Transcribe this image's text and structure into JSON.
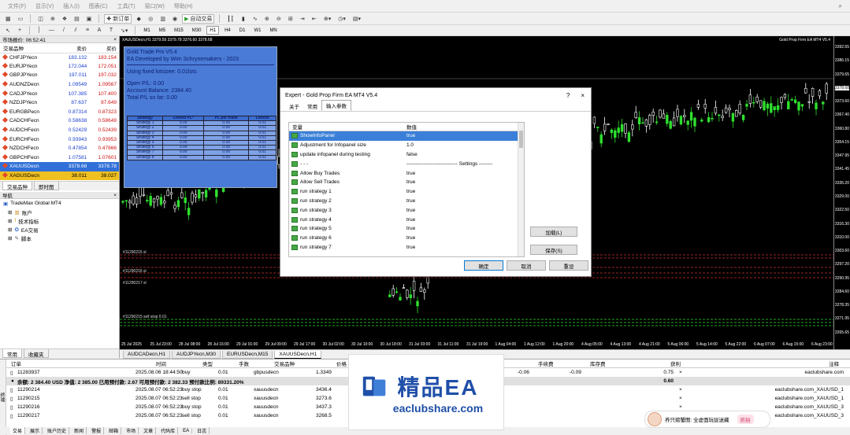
{
  "menu": [
    "文件(F)",
    "显示(V)",
    "插入(I)",
    "图表(C)",
    "工具(T)",
    "窗口(W)",
    "帮助(H)"
  ],
  "toolbar": {
    "new_order": "新订单",
    "auto_trading": "自动交易"
  },
  "timeframes": [
    "M1",
    "M5",
    "M15",
    "M30",
    "H1",
    "H4",
    "D1",
    "W1",
    "MN"
  ],
  "active_timeframe": "H1",
  "market_watch": {
    "title": "市场报价: 06:52:41",
    "headers": [
      "交易品种",
      "卖价",
      "买价"
    ],
    "rows": [
      [
        "CHFJPYecn",
        "183.132",
        "183.154"
      ],
      [
        "EURJPYecn",
        "172.044",
        "172.051"
      ],
      [
        "GBPJPYecn",
        "197.011",
        "197.032"
      ],
      [
        "AUDNZDecn",
        "1.09549",
        "1.09567"
      ],
      [
        "CADJPYecn",
        "107.385",
        "107.400"
      ],
      [
        "NZDJPYecn",
        "87.637",
        "87.649"
      ],
      [
        "EURGBPecn",
        "0.87314",
        "0.87323"
      ],
      [
        "CADCHFecn",
        "0.58638",
        "0.58649"
      ],
      [
        "AUDCHFecn",
        "0.52429",
        "0.52439"
      ],
      [
        "EURCHFecn",
        "0.93943",
        "0.93953"
      ],
      [
        "NZDCHFecn",
        "0.47854",
        "0.47866"
      ],
      [
        "GBPCHFecn",
        "1.07581",
        "1.07601"
      ],
      [
        "XAUUSDecn",
        "3378.68",
        "3378.78"
      ],
      [
        "XAGUSDecn",
        "38.011",
        "38.027"
      ]
    ],
    "tabs": [
      "交易品种",
      "即时图"
    ]
  },
  "navigator": {
    "title": "导航",
    "root": "TradeMax Global MT4",
    "items": [
      "账户",
      "技术指标",
      "EA交易",
      "脚本"
    ],
    "tabs": [
      "常用",
      "收藏夹"
    ]
  },
  "chart": {
    "header": "XAUUSDecn,H1  3379.59 3379.78 3376.60 3378.68",
    "ea_label": "Gold Prop Firm EA MT4 V5.4",
    "price_ticks": [
      "3392.65",
      "3386.15",
      "3379.65",
      "3378.68",
      "3373.60",
      "3367.40",
      "3360.80",
      "3354.15",
      "3347.95",
      "3341.45",
      "3335.20",
      "3329.00",
      "3322.50",
      "3316.30",
      "3310.00",
      "3303.60",
      "3297.20",
      "3290.95",
      "3284.60",
      "3278.35",
      "3271.95",
      "3265.65"
    ],
    "time_ticks": [
      "25 Jul 2025",
      "25 Jul 23:00",
      "28 Jul 08:00",
      "28 Jul 16:00",
      "29 Jul 01:00",
      "29 Jul 09:00",
      "29 Jul 17:00",
      "30 Jul 02:00",
      "30 Jul 10:00",
      "30 Jul 18:00",
      "31 Jul 03:00",
      "31 Jul 11:00",
      "31 Jul 19:00",
      "1 Aug 04:00",
      "1 Aug 12:00",
      "1 Aug 20:00",
      "4 Aug 05:00",
      "4 Aug 13:00",
      "4 Aug 21:00",
      "5 Aug 06:00",
      "5 Aug 14:00",
      "5 Aug 22:00",
      "6 Aug 07:00",
      "6 Aug 15:00",
      "6 Aug 23:00"
    ],
    "order_labels": [
      "#11290215 sl",
      "#11290216 sl",
      "#11290217 sl",
      "#11290215 sell stop 0.01"
    ],
    "tabs": [
      "AUDCADecn,H1",
      "AUDJPYecn,M30",
      "EURUSDecn,M15",
      "XAUUSDecn,H1"
    ]
  },
  "info_panel": {
    "title": "Gold Trade Pro V5.4",
    "developer": "EA Developed by Wim Schrynemakers - 2023",
    "lots": "Using fixed lotsizee: 0.01lots",
    "open_pl": "Open P/L: 0.00",
    "balance": "Account Balance: 2384.40",
    "total_pl": "Total P/L so far: 0.00",
    "headers": [
      "Strategy",
      "Closed PL*",
      "PL per trade",
      "Lotsize"
    ],
    "rows": [
      [
        "Strategy 1",
        "0.00",
        "0.00",
        "0.01"
      ],
      [
        "Strategy 2",
        "0.00",
        "0.00",
        "0.01"
      ],
      [
        "Strategy 3",
        "0.00",
        "0.00",
        "0.01"
      ],
      [
        "Strategy 4",
        "0.00",
        "0.00",
        "0.01"
      ],
      [
        "Strategy 5",
        "0.00",
        "0.00",
        "0.01"
      ],
      [
        "Strategy 6",
        "0.00",
        "0.00",
        "0.01"
      ],
      [
        "Strategy 7",
        "0.00",
        "0.00",
        "0.01"
      ],
      [
        "Strategy 8",
        "0.00",
        "0.00",
        "0.01"
      ]
    ]
  },
  "dialog": {
    "title": "Expert - Gold Prop Firm EA MT4 V5.4",
    "help": "?",
    "close": "×",
    "tabs": [
      "关于",
      "常用",
      "输入参数"
    ],
    "col_var": "变量",
    "col_val": "数值",
    "params": [
      [
        "ShowInfoPanel",
        "true"
      ],
      [
        "Adjustment for Infopanel size",
        "1.0"
      ],
      [
        "update infopanel during testing",
        "false"
      ],
      [
        "- - -",
        "------------------------------ Settings --------"
      ],
      [
        "Allow Buy Trades",
        "true"
      ],
      [
        "Allow Sell Trades",
        "true"
      ],
      [
        "run strategy 1",
        "true"
      ],
      [
        "run strategy 2",
        "true"
      ],
      [
        "run strategy 3",
        "true"
      ],
      [
        "run strategy 4",
        "true"
      ],
      [
        "run strategy 5",
        "true"
      ],
      [
        "run strategy 6",
        "true"
      ],
      [
        "run strategy 7",
        "true"
      ]
    ],
    "load": "加载(L)",
    "save": "保存(S)",
    "ok": "确定",
    "cancel": "取消",
    "reset": "重设"
  },
  "terminal": {
    "headers": [
      "订单",
      "时间",
      "类型",
      "手数",
      "交易品种",
      "价格",
      "手续费",
      "库存费",
      "获利",
      "注释"
    ],
    "rows": [
      [
        "11283937",
        "2025.08.06 18:44:50",
        "buy",
        "0.01",
        "gbpusdecn",
        "1.3349",
        "-0.06",
        "-0.09",
        "0.75",
        "eaclubshare.com"
      ],
      [
        "11290214",
        "2025.08.07 06:52:23",
        "buy stop",
        "0.01",
        "xauusdecn",
        "3436.4",
        "",
        "",
        "",
        "eaclubshare.com_XAUUSD_1"
      ],
      [
        "11290215",
        "2025.08.07 06:52:23",
        "sell stop",
        "0.01",
        "xauusdecn",
        "3273.6",
        "",
        "",
        "",
        "eaclubshare.com_XAUUSD_1"
      ],
      [
        "11290216",
        "2025.08.07 06:52:23",
        "buy stop",
        "0.01",
        "xauusdecn",
        "3437.3",
        "",
        "",
        "",
        "eaclubshare.com_XAUUSD_3"
      ],
      [
        "11290217",
        "2025.08.07 06:52:23",
        "sell stop",
        "0.01",
        "xauusdecn",
        "3268.5",
        "",
        "",
        "",
        "eaclubshare.com_XAUUSD_3"
      ]
    ],
    "balance_line": "余额: 2 384.40 USD  净值: 2 385.00  已用预付款: 2.67  可用预付款: 2 382.33  预付款比例: 89331.20%",
    "balance_profit": "0.60",
    "bottom_tabs": [
      "交易",
      "展示",
      "账户历史",
      "新闻",
      "警报",
      "邮箱",
      "市场",
      "文章",
      "代码库",
      "EA",
      "日志"
    ],
    "side_label": "终端"
  },
  "watermark": {
    "title": "精品EA",
    "url": "eaclubshare.com"
  },
  "promo": {
    "text": "养只螃蟹图: 全虚面玩捉迷藏",
    "tag": "抓拍"
  }
}
